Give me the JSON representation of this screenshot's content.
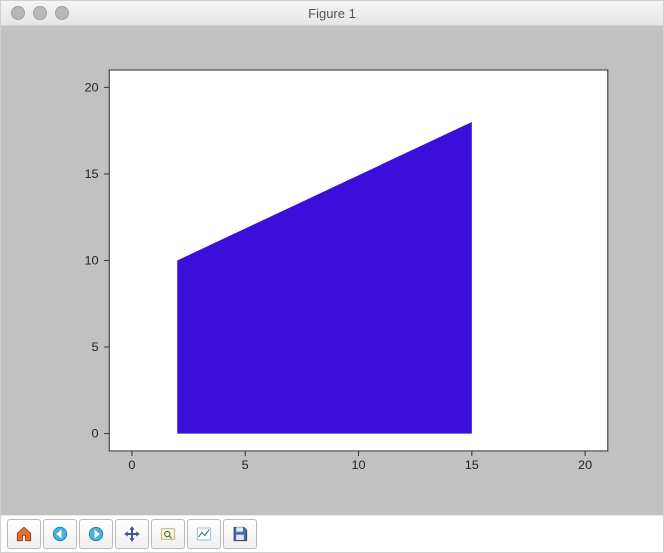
{
  "window": {
    "title": "Figure 1"
  },
  "toolbar": {
    "home": "Home",
    "back": "Back",
    "fwd": "Forward",
    "pan": "Pan",
    "zoom": "Zoom",
    "config": "Configure subplots",
    "save": "Save"
  },
  "chart_data": {
    "type": "area",
    "shape": "polygon",
    "title": "",
    "xlabel": "",
    "ylabel": "",
    "xlim": [
      -1,
      21
    ],
    "ylim": [
      -1,
      21
    ],
    "xticks": [
      0,
      5,
      10,
      15,
      20
    ],
    "yticks": [
      0,
      5,
      10,
      15,
      20
    ],
    "fill_color": "#3a0fd9",
    "vertices": [
      {
        "x": 2,
        "y": 0
      },
      {
        "x": 2,
        "y": 10
      },
      {
        "x": 15,
        "y": 18
      },
      {
        "x": 15,
        "y": 0
      }
    ]
  },
  "ticks": {
    "x0": "0",
    "x1": "5",
    "x2": "10",
    "x3": "15",
    "x4": "20",
    "y0": "0",
    "y1": "5",
    "y2": "10",
    "y3": "15",
    "y4": "20"
  }
}
